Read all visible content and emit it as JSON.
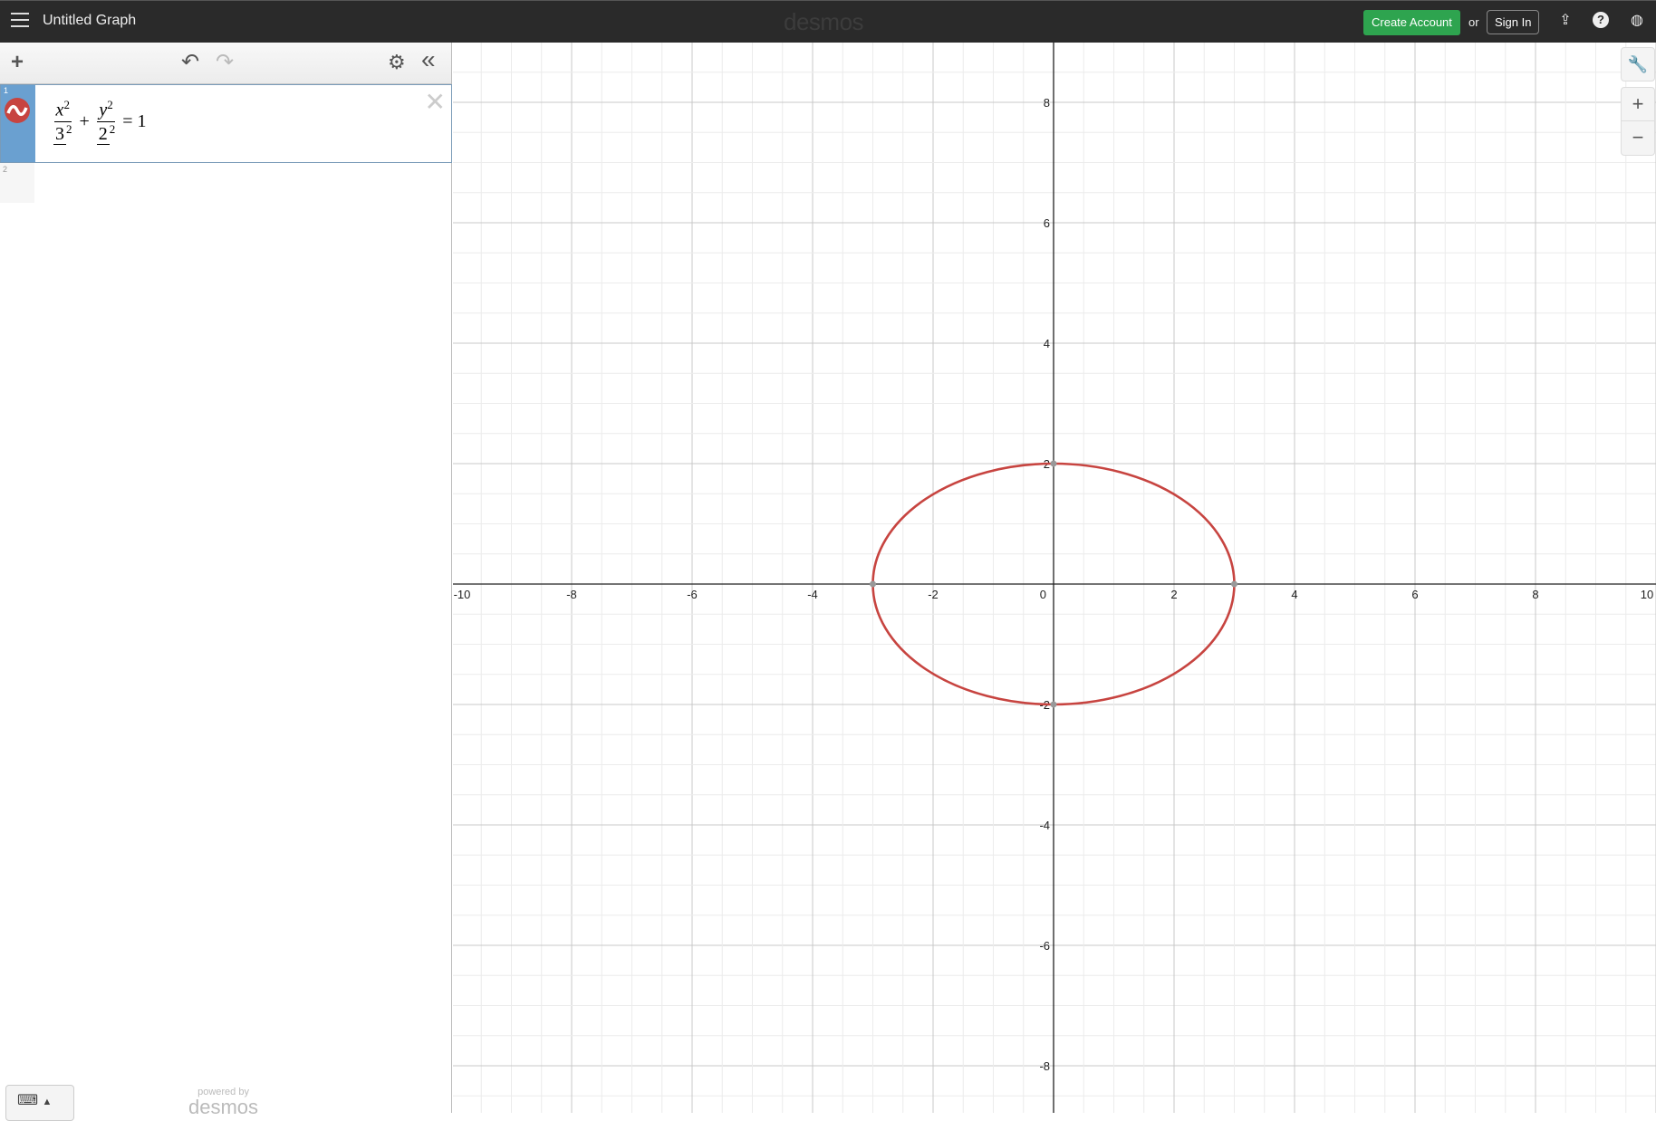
{
  "header": {
    "title": "Untitled Graph",
    "logo": "desmos",
    "create_account": "Create Account",
    "or": "or",
    "sign_in": "Sign In"
  },
  "toolbar": {
    "add": "+",
    "undo": "↶",
    "redo": "↷",
    "settings": "⚙",
    "collapse": "«"
  },
  "expressions": [
    {
      "index": "1",
      "latex": "x^2/3^2 + y^2/2^2 = 1",
      "num_x": "x",
      "num_y": "y",
      "den1": "3",
      "den2": "2",
      "exp": "2",
      "rhs": "= 1",
      "color": "#c74440"
    },
    {
      "index": "2"
    }
  ],
  "footer": {
    "powered_by": "powered by",
    "brand": "desmos"
  },
  "chart_data": {
    "type": "line",
    "title": "",
    "xlabel": "",
    "ylabel": "",
    "xlim": [
      -10,
      10
    ],
    "ylim": [
      -8.9,
      8.9
    ],
    "x_ticks": [
      -10,
      -8,
      -6,
      -4,
      -2,
      0,
      2,
      4,
      6,
      8,
      10
    ],
    "y_ticks": [
      -8,
      -6,
      -4,
      -2,
      2,
      4,
      6,
      8
    ],
    "grid": true,
    "minor_step": 0.5,
    "series": [
      {
        "name": "x^2/3^2+y^2/2^2=1",
        "kind": "ellipse",
        "a": 3,
        "b": 2,
        "color": "#c74440",
        "points_of_interest": [
          [
            -3,
            0
          ],
          [
            3,
            0
          ],
          [
            0,
            2
          ],
          [
            0,
            -2
          ]
        ]
      }
    ]
  }
}
